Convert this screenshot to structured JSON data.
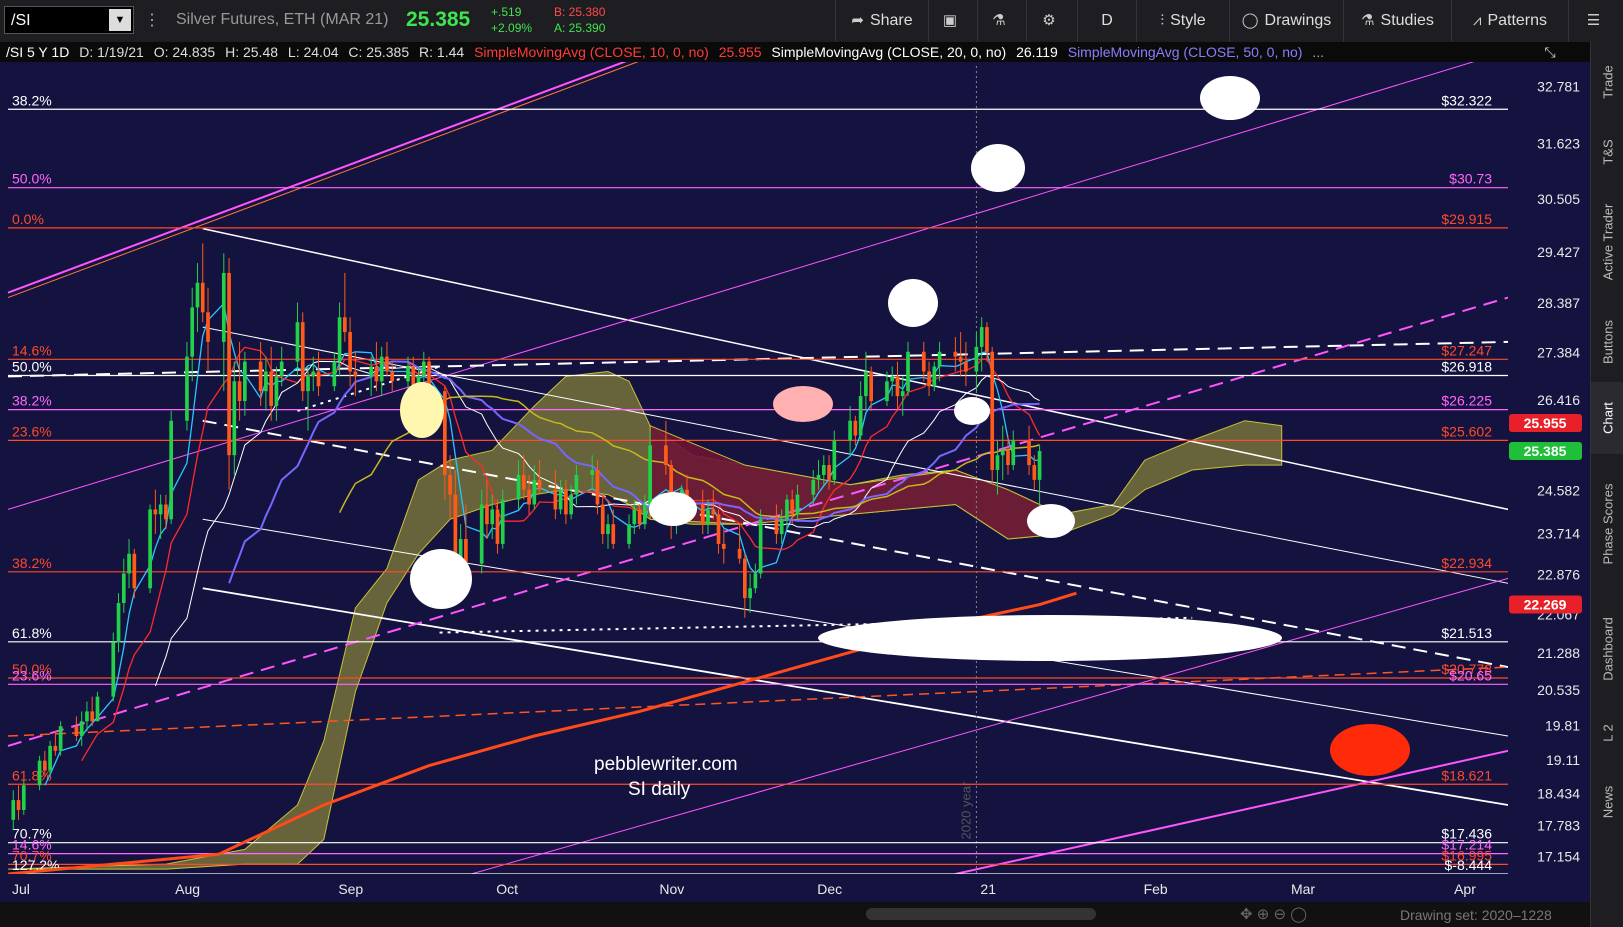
{
  "toolbar": {
    "symbol": "/SI",
    "description": "Silver Futures, ETH (MAR 21)",
    "last": "25.385",
    "change": "+.519",
    "change_pct": "+2.09%",
    "bid": "B: 25.380",
    "ask": "A: 25.390",
    "share_label": "Share",
    "period_label": "D",
    "style_label": "Style",
    "drawings_label": "Drawings",
    "studies_label": "Studies",
    "patterns_label": "Patterns"
  },
  "infobar": {
    "header": "/SI 5 Y 1D",
    "date": "D: 1/19/21",
    "open": "O: 24.835",
    "high": "H: 25.48",
    "low": "L: 24.04",
    "close": "C: 25.385",
    "range": "R: 1.44",
    "sma10": "SimpleMovingAvg (CLOSE, 10, 0, no)",
    "sma10_val": "25.955",
    "sma20": "SimpleMovingAvg (CLOSE, 20, 0, no)",
    "sma20_val": "26.119",
    "sma50": "SimpleMovingAvg (CLOSE, 50, 0, no)",
    "more": "..."
  },
  "right_panel": [
    "Trade",
    "T&S",
    "Active Trader",
    "Buttons",
    "Chart",
    "Phase Scores",
    "Dashboard",
    "L 2",
    "News"
  ],
  "bottom": {
    "drawing_set": "Drawing set: 2020–1228"
  },
  "chart_data": {
    "type": "candlestick",
    "ylim": [
      16.8,
      33.2
    ],
    "y_ticks": [
      32.781,
      31.623,
      30.505,
      29.427,
      28.387,
      27.384,
      26.416,
      24.582,
      23.714,
      22.876,
      22.067,
      21.288,
      20.535,
      19.81,
      19.11,
      18.434,
      17.783,
      17.154
    ],
    "y_tick_labels": [
      "32.781",
      "31.623",
      "30.505",
      "29.427",
      "28.387",
      "27.384",
      "26.416",
      "24.582",
      "23.714",
      "22.876",
      "22.067",
      "21.288",
      "20.535",
      "19.81",
      "19.11",
      "18.434",
      "17.783",
      "17.154"
    ],
    "x_labels": [
      {
        "label": "Jul",
        "day": 0
      },
      {
        "label": "Aug",
        "day": 31
      },
      {
        "label": "Sep",
        "day": 62
      },
      {
        "label": "Oct",
        "day": 92
      },
      {
        "label": "Nov",
        "day": 123
      },
      {
        "label": "Dec",
        "day": 153
      },
      {
        "label": "21",
        "day": 184
      },
      {
        "label": "Feb",
        "day": 215
      },
      {
        "label": "Mar",
        "day": 243
      },
      {
        "label": "Apr",
        "day": 274
      }
    ],
    "x_range_days": [
      0,
      285
    ],
    "year_marker": {
      "label": "2020 year",
      "day": 184
    },
    "price_bubbles": [
      {
        "label": "25.955",
        "value": 25.955,
        "color": "#e8202a"
      },
      {
        "label": "25.385",
        "value": 25.385,
        "color": "#1fbf3a"
      },
      {
        "label": "22.269",
        "value": 22.269,
        "color": "#e8202a"
      }
    ],
    "fib_levels": [
      {
        "left": "38.2%",
        "right": "$32.322",
        "value": 32.322,
        "color": "#ffffff"
      },
      {
        "left": "50.0%",
        "right": "$30.73",
        "value": 30.73,
        "color": "#ff66ff"
      },
      {
        "left": "0.0%",
        "right": "$29.915",
        "value": 29.915,
        "color": "#ff4a2a"
      },
      {
        "left": "14.6%",
        "right": "$27.247",
        "value": 27.247,
        "color": "#ff4a2a"
      },
      {
        "left": "50.0%",
        "right": "$26.918",
        "value": 26.918,
        "color": "#ffffff"
      },
      {
        "left": "38.2%",
        "right": "$26.225",
        "value": 26.225,
        "color": "#ff66ff"
      },
      {
        "left": "23.6%",
        "right": "$25.602",
        "value": 25.602,
        "color": "#ff4a2a"
      },
      {
        "left": "38.2%",
        "right": "$22.934",
        "value": 22.934,
        "color": "#ff4a2a"
      },
      {
        "left": "61.8%",
        "right": "$21.513",
        "value": 21.513,
        "color": "#ffffff"
      },
      {
        "left": "50.0%",
        "right": "$20.778",
        "value": 20.778,
        "color": "#ff4a2a"
      },
      {
        "left": "23.6%",
        "right": "$20.65",
        "value": 20.65,
        "color": "#ff66ff"
      },
      {
        "left": "61.8%",
        "right": "$18.621",
        "value": 18.621,
        "color": "#ff4a2a"
      },
      {
        "left": "70.7%",
        "right": "$17.436",
        "value": 17.436,
        "color": "#ffffff"
      },
      {
        "left": "14.6%",
        "right": "$17.214",
        "value": 17.214,
        "color": "#ff66ff"
      },
      {
        "left": "70.7%",
        "right": "$16.995",
        "value": 16.995,
        "color": "#ff4a2a"
      },
      {
        "left": "127.2%",
        "right": "$-8.444",
        "value": 16.8,
        "color": "#ffffff"
      }
    ],
    "candles": [
      [
        1,
        17.9,
        18.5,
        17.7,
        18.3
      ],
      [
        2,
        18.3,
        18.6,
        17.9,
        18.1
      ],
      [
        3,
        18.1,
        18.7,
        18.0,
        18.6
      ],
      [
        6,
        18.6,
        19.2,
        18.5,
        19.1
      ],
      [
        7,
        19.1,
        19.3,
        18.8,
        18.9
      ],
      [
        8,
        18.9,
        19.5,
        18.8,
        19.4
      ],
      [
        9,
        19.4,
        19.7,
        19.2,
        19.3
      ],
      [
        10,
        19.3,
        19.9,
        19.2,
        19.8
      ],
      [
        13,
        19.8,
        20.0,
        19.5,
        19.6
      ],
      [
        14,
        19.6,
        20.1,
        19.4,
        19.9
      ],
      [
        15,
        19.9,
        20.3,
        19.7,
        20.1
      ],
      [
        16,
        20.1,
        20.4,
        19.8,
        19.9
      ],
      [
        17,
        19.9,
        20.5,
        19.9,
        20.4
      ],
      [
        20,
        20.4,
        21.7,
        20.3,
        21.5
      ],
      [
        21,
        21.5,
        22.5,
        21.3,
        22.3
      ],
      [
        22,
        22.3,
        23.2,
        22.1,
        22.9
      ],
      [
        23,
        22.9,
        23.6,
        22.6,
        23.3
      ],
      [
        24,
        23.3,
        23.4,
        22.4,
        22.6
      ],
      [
        27,
        22.6,
        24.3,
        22.5,
        24.2
      ],
      [
        28,
        24.2,
        24.6,
        23.7,
        24.1
      ],
      [
        29,
        24.1,
        24.5,
        23.6,
        24.3
      ],
      [
        30,
        24.3,
        24.5,
        23.8,
        24.0
      ],
      [
        31,
        24.0,
        26.2,
        23.9,
        26.0
      ],
      [
        34,
        26.0,
        27.6,
        25.8,
        27.3
      ],
      [
        35,
        27.3,
        28.7,
        26.8,
        28.3
      ],
      [
        36,
        28.3,
        29.2,
        27.8,
        28.8
      ],
      [
        37,
        28.8,
        29.6,
        28.0,
        28.2
      ],
      [
        38,
        28.2,
        28.7,
        27.0,
        27.6
      ],
      [
        41,
        27.6,
        29.4,
        26.6,
        29.0
      ],
      [
        42,
        29.0,
        29.3,
        24.6,
        25.3
      ],
      [
        43,
        25.3,
        27.2,
        24.9,
        26.8
      ],
      [
        44,
        26.8,
        27.6,
        26.0,
        26.4
      ],
      [
        45,
        26.4,
        27.4,
        26.1,
        27.2
      ],
      [
        48,
        27.2,
        27.6,
        26.3,
        26.6
      ],
      [
        49,
        26.6,
        27.3,
        26.2,
        27.0
      ],
      [
        50,
        27.0,
        27.5,
        26.0,
        26.3
      ],
      [
        51,
        26.3,
        27.1,
        26.0,
        26.9
      ],
      [
        52,
        26.9,
        27.5,
        26.7,
        27.2
      ],
      [
        55,
        27.2,
        28.4,
        26.9,
        28.0
      ],
      [
        56,
        28.0,
        28.2,
        26.4,
        26.6
      ],
      [
        57,
        26.6,
        27.1,
        25.8,
        26.9
      ],
      [
        58,
        26.9,
        27.3,
        26.6,
        27.0
      ],
      [
        59,
        27.0,
        27.4,
        26.5,
        26.7
      ],
      [
        62,
        26.7,
        27.4,
        26.6,
        27.2
      ],
      [
        63,
        27.2,
        28.4,
        26.9,
        28.1
      ],
      [
        64,
        28.1,
        29.0,
        27.6,
        27.8
      ],
      [
        65,
        27.8,
        28.1,
        26.7,
        27.0
      ],
      [
        66,
        27.0,
        27.4,
        26.5,
        26.9
      ],
      [
        69,
        26.9,
        27.3,
        26.5,
        27.1
      ],
      [
        70,
        27.1,
        27.6,
        26.6,
        26.8
      ],
      [
        71,
        26.8,
        27.5,
        26.5,
        27.3
      ],
      [
        72,
        27.3,
        27.6,
        26.9,
        27.0
      ],
      [
        73,
        27.0,
        27.2,
        26.6,
        26.8
      ],
      [
        76,
        26.8,
        27.3,
        26.6,
        27.1
      ],
      [
        77,
        27.1,
        27.3,
        26.3,
        26.5
      ],
      [
        78,
        26.5,
        27.1,
        26.3,
        26.9
      ],
      [
        79,
        26.9,
        27.4,
        26.7,
        27.2
      ],
      [
        80,
        27.2,
        27.3,
        26.4,
        26.6
      ],
      [
        83,
        26.6,
        26.7,
        24.4,
        24.9
      ],
      [
        84,
        24.9,
        25.3,
        24.0,
        24.5
      ],
      [
        85,
        24.5,
        25.0,
        22.8,
        23.2
      ],
      [
        86,
        23.2,
        23.9,
        22.6,
        23.6
      ],
      [
        87,
        23.6,
        24.3,
        22.9,
        23.1
      ],
      [
        90,
        23.1,
        24.6,
        22.9,
        24.3
      ],
      [
        91,
        24.3,
        24.8,
        23.6,
        23.9
      ],
      [
        92,
        23.9,
        24.5,
        23.6,
        24.2
      ],
      [
        93,
        24.2,
        24.4,
        23.3,
        23.5
      ],
      [
        94,
        23.5,
        24.6,
        23.4,
        24.4
      ],
      [
        97,
        24.4,
        25.2,
        24.2,
        24.9
      ],
      [
        98,
        24.9,
        25.3,
        24.4,
        24.6
      ],
      [
        99,
        24.6,
        24.9,
        24.1,
        24.3
      ],
      [
        100,
        24.3,
        25.1,
        24.2,
        24.8
      ],
      [
        101,
        24.8,
        25.2,
        24.5,
        24.6
      ],
      [
        104,
        24.6,
        25.0,
        24.0,
        24.2
      ],
      [
        105,
        24.2,
        24.8,
        24.1,
        24.6
      ],
      [
        106,
        24.6,
        24.8,
        23.9,
        24.1
      ],
      [
        107,
        24.1,
        24.7,
        24.0,
        24.5
      ],
      [
        108,
        24.5,
        25.1,
        24.3,
        24.9
      ],
      [
        111,
        24.9,
        25.3,
        24.6,
        25.0
      ],
      [
        112,
        25.0,
        25.2,
        24.1,
        24.3
      ],
      [
        113,
        24.3,
        24.5,
        23.5,
        23.7
      ],
      [
        114,
        23.7,
        24.1,
        23.4,
        23.9
      ],
      [
        115,
        23.9,
        24.2,
        23.4,
        23.5
      ],
      [
        118,
        23.5,
        24.1,
        23.4,
        23.9
      ],
      [
        119,
        23.9,
        24.4,
        23.7,
        24.2
      ],
      [
        120,
        24.2,
        24.3,
        23.8,
        23.9
      ],
      [
        121,
        23.9,
        24.5,
        23.8,
        24.3
      ],
      [
        122,
        24.3,
        25.8,
        24.2,
        25.5
      ],
      [
        125,
        25.5,
        26.0,
        24.9,
        25.1
      ],
      [
        126,
        25.1,
        25.2,
        23.6,
        23.9
      ],
      [
        127,
        23.9,
        24.4,
        23.7,
        24.1
      ],
      [
        128,
        24.1,
        24.7,
        24.0,
        24.6
      ],
      [
        129,
        24.6,
        24.9,
        24.1,
        24.3
      ],
      [
        132,
        24.3,
        24.6,
        23.7,
        23.9
      ],
      [
        133,
        23.9,
        24.4,
        23.7,
        24.2
      ],
      [
        134,
        24.2,
        24.6,
        24.0,
        24.1
      ],
      [
        135,
        24.1,
        24.2,
        23.3,
        23.5
      ],
      [
        136,
        23.5,
        23.8,
        23.1,
        23.4
      ],
      [
        139,
        23.4,
        23.9,
        23.1,
        23.2
      ],
      [
        140,
        23.2,
        23.3,
        22.0,
        22.4
      ],
      [
        141,
        22.4,
        22.9,
        22.1,
        22.6
      ],
      [
        142,
        22.6,
        23.1,
        22.5,
        22.9
      ],
      [
        143,
        22.9,
        24.2,
        22.8,
        24.0
      ],
      [
        146,
        24.0,
        24.3,
        23.5,
        23.7
      ],
      [
        147,
        23.7,
        24.2,
        23.5,
        24.0
      ],
      [
        148,
        24.0,
        24.5,
        23.8,
        24.4
      ],
      [
        149,
        24.4,
        24.6,
        23.9,
        24.1
      ],
      [
        150,
        24.1,
        24.7,
        24.0,
        24.5
      ],
      [
        153,
        24.5,
        25.0,
        24.3,
        24.8
      ],
      [
        154,
        24.8,
        25.2,
        24.6,
        24.9
      ],
      [
        155,
        24.9,
        25.3,
        24.7,
        25.1
      ],
      [
        156,
        25.1,
        25.3,
        24.6,
        24.8
      ],
      [
        157,
        24.8,
        25.8,
        24.7,
        25.6
      ],
      [
        160,
        25.6,
        26.3,
        25.3,
        26.0
      ],
      [
        161,
        26.0,
        26.1,
        25.5,
        25.7
      ],
      [
        162,
        25.7,
        26.8,
        25.6,
        26.5
      ],
      [
        163,
        26.5,
        27.4,
        26.2,
        27.0
      ],
      [
        164,
        27.0,
        27.1,
        26.2,
        26.4
      ],
      [
        167,
        26.4,
        27.0,
        26.3,
        26.8
      ],
      [
        168,
        26.8,
        27.1,
        26.5,
        26.9
      ],
      [
        169,
        26.9,
        27.2,
        26.2,
        26.5
      ],
      [
        170,
        26.5,
        26.9,
        26.1,
        26.6
      ],
      [
        171,
        26.6,
        27.6,
        26.5,
        27.4
      ],
      [
        174,
        27.4,
        27.6,
        26.8,
        27.0
      ],
      [
        175,
        27.0,
        27.2,
        26.5,
        26.7
      ],
      [
        176,
        26.7,
        27.2,
        26.6,
        27.1
      ],
      [
        177,
        27.1,
        27.6,
        26.8,
        27.4
      ],
      [
        180,
        27.4,
        27.7,
        27.0,
        27.3
      ],
      [
        181,
        27.3,
        27.8,
        26.9,
        27.2
      ],
      [
        182,
        27.2,
        27.6,
        26.7,
        27.0
      ],
      [
        184,
        27.0,
        27.8,
        26.6,
        27.5
      ],
      [
        185,
        27.5,
        28.1,
        27.0,
        27.9
      ],
      [
        186,
        27.9,
        28.0,
        27.2,
        27.4
      ],
      [
        187,
        27.4,
        27.5,
        24.7,
        25.0
      ],
      [
        188,
        25.0,
        25.6,
        24.5,
        25.3
      ],
      [
        189,
        25.3,
        25.9,
        24.8,
        25.4
      ],
      [
        190,
        25.4,
        25.7,
        24.9,
        25.1
      ],
      [
        191,
        25.1,
        25.8,
        25.0,
        25.6
      ],
      [
        194,
        25.6,
        25.9,
        24.9,
        25.1
      ],
      [
        195,
        25.1,
        25.3,
        24.6,
        24.8
      ],
      [
        196,
        24.8,
        25.5,
        24.0,
        25.385
      ]
    ]
  }
}
